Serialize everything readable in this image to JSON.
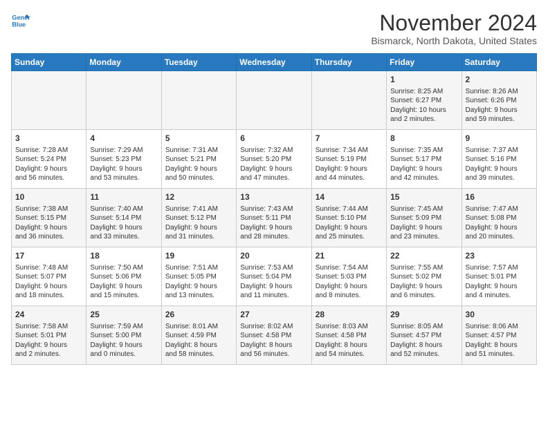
{
  "header": {
    "logo_line1": "General",
    "logo_line2": "Blue",
    "month_title": "November 2024",
    "location": "Bismarck, North Dakota, United States"
  },
  "weekdays": [
    "Sunday",
    "Monday",
    "Tuesday",
    "Wednesday",
    "Thursday",
    "Friday",
    "Saturday"
  ],
  "weeks": [
    [
      {
        "day": "",
        "info": ""
      },
      {
        "day": "",
        "info": ""
      },
      {
        "day": "",
        "info": ""
      },
      {
        "day": "",
        "info": ""
      },
      {
        "day": "",
        "info": ""
      },
      {
        "day": "1",
        "info": "Sunrise: 8:25 AM\nSunset: 6:27 PM\nDaylight: 10 hours\nand 2 minutes."
      },
      {
        "day": "2",
        "info": "Sunrise: 8:26 AM\nSunset: 6:26 PM\nDaylight: 9 hours\nand 59 minutes."
      }
    ],
    [
      {
        "day": "3",
        "info": "Sunrise: 7:28 AM\nSunset: 5:24 PM\nDaylight: 9 hours\nand 56 minutes."
      },
      {
        "day": "4",
        "info": "Sunrise: 7:29 AM\nSunset: 5:23 PM\nDaylight: 9 hours\nand 53 minutes."
      },
      {
        "day": "5",
        "info": "Sunrise: 7:31 AM\nSunset: 5:21 PM\nDaylight: 9 hours\nand 50 minutes."
      },
      {
        "day": "6",
        "info": "Sunrise: 7:32 AM\nSunset: 5:20 PM\nDaylight: 9 hours\nand 47 minutes."
      },
      {
        "day": "7",
        "info": "Sunrise: 7:34 AM\nSunset: 5:19 PM\nDaylight: 9 hours\nand 44 minutes."
      },
      {
        "day": "8",
        "info": "Sunrise: 7:35 AM\nSunset: 5:17 PM\nDaylight: 9 hours\nand 42 minutes."
      },
      {
        "day": "9",
        "info": "Sunrise: 7:37 AM\nSunset: 5:16 PM\nDaylight: 9 hours\nand 39 minutes."
      }
    ],
    [
      {
        "day": "10",
        "info": "Sunrise: 7:38 AM\nSunset: 5:15 PM\nDaylight: 9 hours\nand 36 minutes."
      },
      {
        "day": "11",
        "info": "Sunrise: 7:40 AM\nSunset: 5:14 PM\nDaylight: 9 hours\nand 33 minutes."
      },
      {
        "day": "12",
        "info": "Sunrise: 7:41 AM\nSunset: 5:12 PM\nDaylight: 9 hours\nand 31 minutes."
      },
      {
        "day": "13",
        "info": "Sunrise: 7:43 AM\nSunset: 5:11 PM\nDaylight: 9 hours\nand 28 minutes."
      },
      {
        "day": "14",
        "info": "Sunrise: 7:44 AM\nSunset: 5:10 PM\nDaylight: 9 hours\nand 25 minutes."
      },
      {
        "day": "15",
        "info": "Sunrise: 7:45 AM\nSunset: 5:09 PM\nDaylight: 9 hours\nand 23 minutes."
      },
      {
        "day": "16",
        "info": "Sunrise: 7:47 AM\nSunset: 5:08 PM\nDaylight: 9 hours\nand 20 minutes."
      }
    ],
    [
      {
        "day": "17",
        "info": "Sunrise: 7:48 AM\nSunset: 5:07 PM\nDaylight: 9 hours\nand 18 minutes."
      },
      {
        "day": "18",
        "info": "Sunrise: 7:50 AM\nSunset: 5:06 PM\nDaylight: 9 hours\nand 15 minutes."
      },
      {
        "day": "19",
        "info": "Sunrise: 7:51 AM\nSunset: 5:05 PM\nDaylight: 9 hours\nand 13 minutes."
      },
      {
        "day": "20",
        "info": "Sunrise: 7:53 AM\nSunset: 5:04 PM\nDaylight: 9 hours\nand 11 minutes."
      },
      {
        "day": "21",
        "info": "Sunrise: 7:54 AM\nSunset: 5:03 PM\nDaylight: 9 hours\nand 8 minutes."
      },
      {
        "day": "22",
        "info": "Sunrise: 7:55 AM\nSunset: 5:02 PM\nDaylight: 9 hours\nand 6 minutes."
      },
      {
        "day": "23",
        "info": "Sunrise: 7:57 AM\nSunset: 5:01 PM\nDaylight: 9 hours\nand 4 minutes."
      }
    ],
    [
      {
        "day": "24",
        "info": "Sunrise: 7:58 AM\nSunset: 5:01 PM\nDaylight: 9 hours\nand 2 minutes."
      },
      {
        "day": "25",
        "info": "Sunrise: 7:59 AM\nSunset: 5:00 PM\nDaylight: 9 hours\nand 0 minutes."
      },
      {
        "day": "26",
        "info": "Sunrise: 8:01 AM\nSunset: 4:59 PM\nDaylight: 8 hours\nand 58 minutes."
      },
      {
        "day": "27",
        "info": "Sunrise: 8:02 AM\nSunset: 4:58 PM\nDaylight: 8 hours\nand 56 minutes."
      },
      {
        "day": "28",
        "info": "Sunrise: 8:03 AM\nSunset: 4:58 PM\nDaylight: 8 hours\nand 54 minutes."
      },
      {
        "day": "29",
        "info": "Sunrise: 8:05 AM\nSunset: 4:57 PM\nDaylight: 8 hours\nand 52 minutes."
      },
      {
        "day": "30",
        "info": "Sunrise: 8:06 AM\nSunset: 4:57 PM\nDaylight: 8 hours\nand 51 minutes."
      }
    ]
  ]
}
